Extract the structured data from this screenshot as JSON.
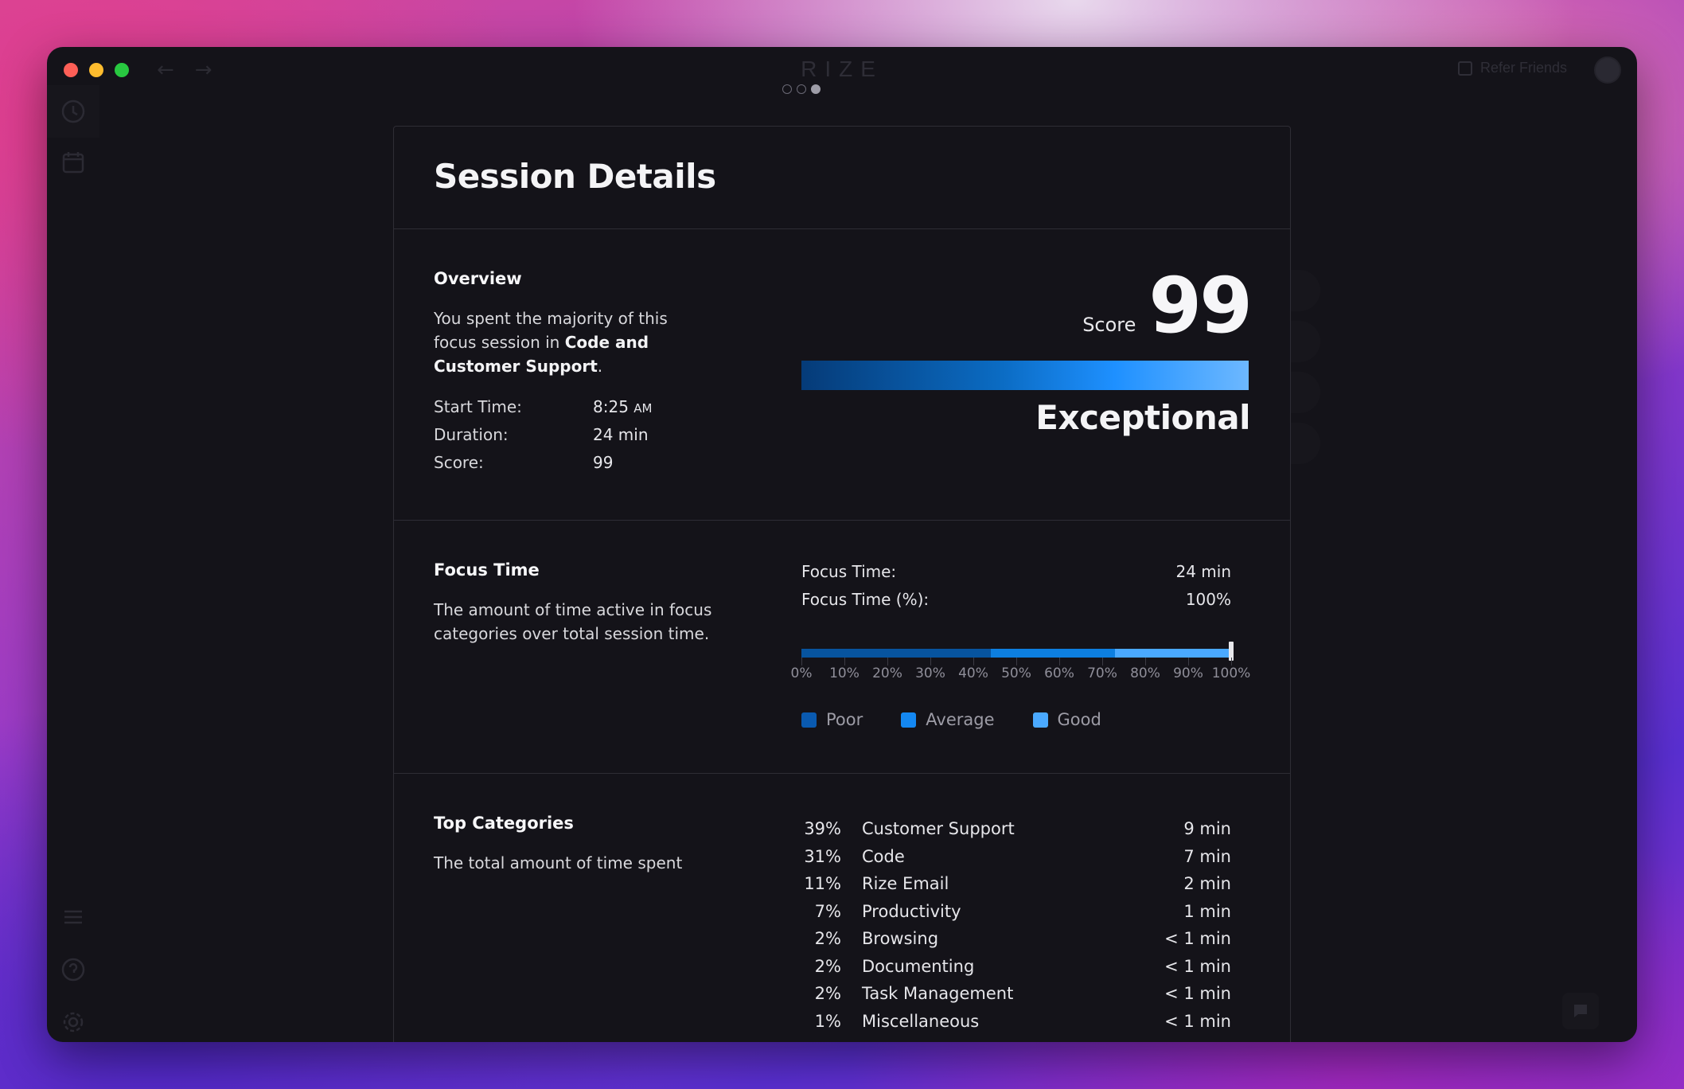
{
  "app": {
    "brand": "RIZE",
    "refer_label": "Refer Friends",
    "page_dots": [
      false,
      false,
      true
    ]
  },
  "panel": {
    "title": "Session Details"
  },
  "overview": {
    "title": "Overview",
    "desc_prefix": "You spent the majority of this focus session in ",
    "desc_bold": "Code and Customer Support",
    "desc_suffix": ".",
    "start_label": "Start Time:",
    "start_value": "8:25",
    "start_ampm": "AM",
    "duration_label": "Duration:",
    "duration_value": "24 min",
    "score_label": "Score:",
    "score_value": "99",
    "big_score_label": "Score",
    "big_score": "99",
    "score_fraction": 0.99,
    "rating": "Exceptional"
  },
  "focus_time": {
    "title": "Focus Time",
    "desc": "The amount of time active in focus categories over total session time.",
    "time_label": "Focus Time:",
    "time_value": "24 min",
    "pct_label": "Focus Time (%):",
    "pct_value": "100%",
    "percent": 100,
    "segments": [
      {
        "name": "Poor",
        "from": 0,
        "to": 44,
        "color": "#07549f"
      },
      {
        "name": "Average",
        "from": 44,
        "to": 73,
        "color": "#0d7fe0"
      },
      {
        "name": "Good",
        "from": 73,
        "to": 100,
        "color": "#4aa9ff"
      }
    ],
    "tick_labels": [
      "0%",
      "10%",
      "20%",
      "30%",
      "40%",
      "50%",
      "60%",
      "70%",
      "80%",
      "90%",
      "100%"
    ],
    "legend": [
      {
        "label": "Poor",
        "color": "#0a5ab0"
      },
      {
        "label": "Average",
        "color": "#1488f2"
      },
      {
        "label": "Good",
        "color": "#4aa9ff"
      }
    ]
  },
  "top_categories": {
    "title": "Top Categories",
    "desc": "The total amount of time spent",
    "items": [
      {
        "pct": "39%",
        "name": "Customer Support",
        "time": "9 min"
      },
      {
        "pct": "31%",
        "name": "Code",
        "time": "7 min"
      },
      {
        "pct": "11%",
        "name": "Rize Email",
        "time": "2 min"
      },
      {
        "pct": "7%",
        "name": "Productivity",
        "time": "1 min"
      },
      {
        "pct": "2%",
        "name": "Browsing",
        "time": "< 1 min"
      },
      {
        "pct": "2%",
        "name": "Documenting",
        "time": "< 1 min"
      },
      {
        "pct": "2%",
        "name": "Task Management",
        "time": "< 1 min"
      },
      {
        "pct": "1%",
        "name": "Miscellaneous",
        "time": "< 1 min"
      }
    ]
  }
}
